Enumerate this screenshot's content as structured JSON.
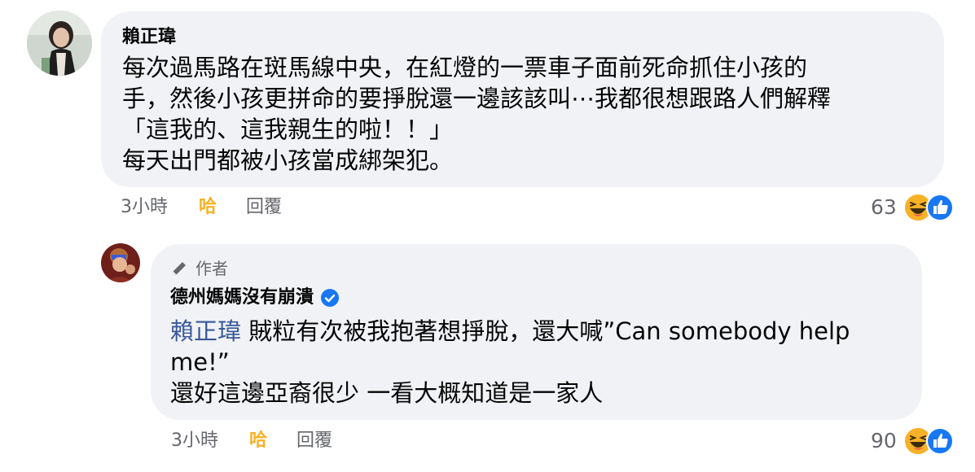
{
  "comment1": {
    "author": "賴正瑋",
    "lines": [
      "每次過馬路在斑馬線中央，在紅燈的一票車子面前死命抓住小孩的",
      "手，然後小孩更拼命的要掙脫還一邊該該叫⋯我都很想跟路人們解釋",
      "「這我的、這我親生的啦！！」",
      "每天出門都被小孩當成綁架犯。"
    ],
    "time": "3小時",
    "haha_label": "哈",
    "reply_label": "回覆",
    "reaction_count": "63"
  },
  "reply1": {
    "author_tag": "作者",
    "author": "德州媽媽沒有崩潰",
    "mention": "賴正瑋",
    "line1_rest": " 賊粒有次被我抱著想掙脫，還大喊”Can somebody help",
    "line2": "me!”",
    "line3": "還好這邊亞裔很少 一看大概知道是一家人",
    "time": "3小時",
    "haha_label": "哈",
    "reply_label": "回覆",
    "reaction_count": "90"
  },
  "colors": {
    "bubble_bg": "#f0f2f5",
    "meta_gray": "#65676b",
    "haha_yellow": "#f7b125",
    "like_blue": "#1877f2",
    "mention_blue": "#385898"
  },
  "icons": [
    "haha-reaction-icon",
    "like-reaction-icon",
    "pencil-icon",
    "verified-badge-icon"
  ]
}
